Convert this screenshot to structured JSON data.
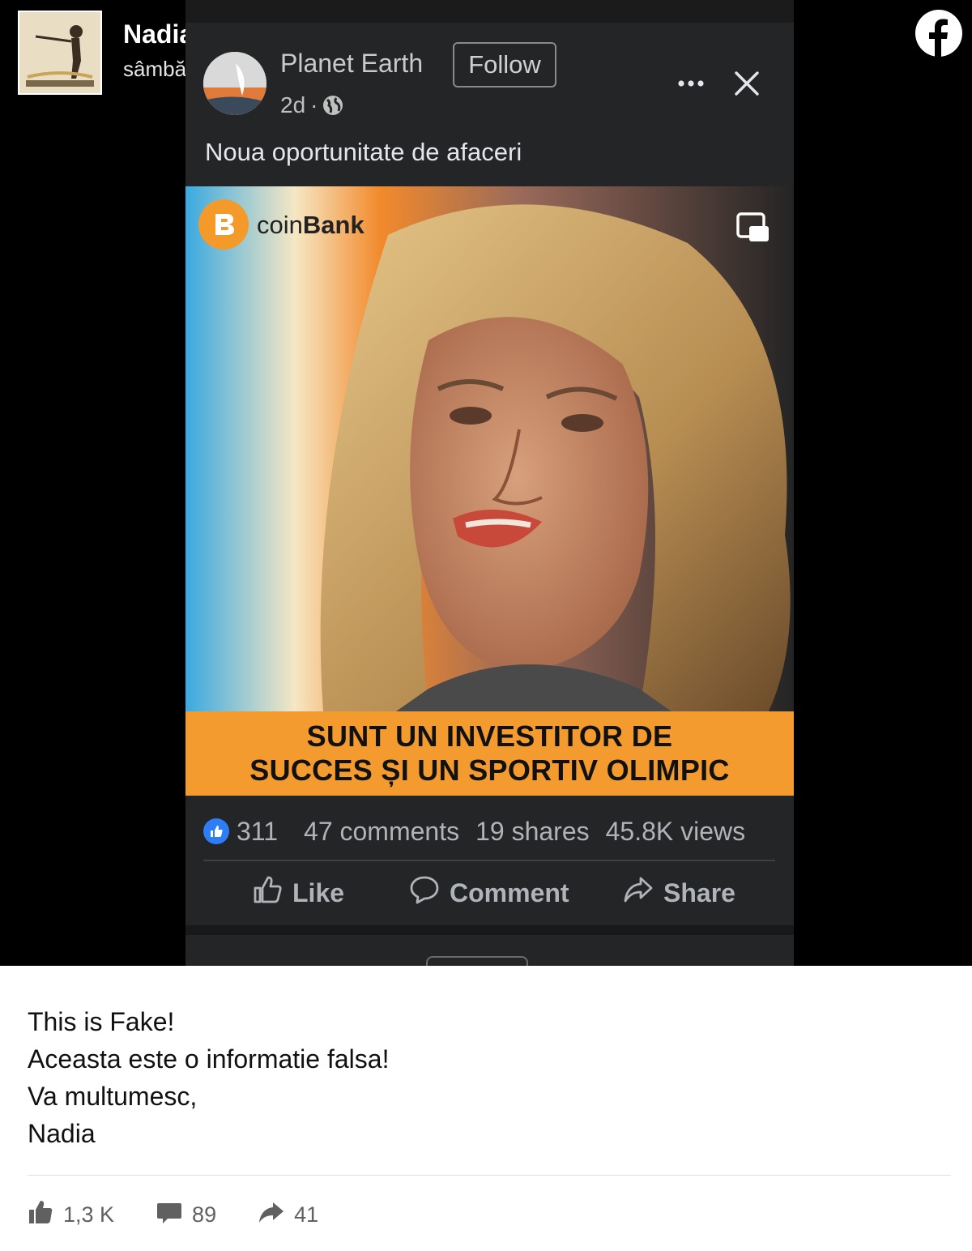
{
  "author": {
    "name": "Nadia Comaneci",
    "date": "sâmbătă"
  },
  "embedded_post": {
    "page_name": "Planet Earth",
    "follow_label": "Follow",
    "age": "2d",
    "age_separator": "·",
    "caption": "Noua oportunitate de afaceri",
    "brand": {
      "prefix": "coin",
      "suffix": "Bank"
    },
    "banner_lines": [
      "SUNT UN INVESTITOR DE",
      "SUCCES ȘI UN SPORTIV OLIMPIC"
    ],
    "stats": {
      "likes": "311",
      "comments": "47 comments",
      "shares": "19 shares",
      "views": "45.8K views"
    },
    "actions": {
      "like": "Like",
      "comment": "Comment",
      "share": "Share"
    }
  },
  "message": [
    "This is Fake!",
    "Aceasta este o informatie falsa!",
    "Va multumesc,",
    "Nadia"
  ],
  "footer": {
    "likes": "1,3 K",
    "comments": "89",
    "shares": "41"
  },
  "colors": {
    "accent_blue": "#2e7cf6",
    "banner_orange": "#f49b2f",
    "post_bg": "#242526"
  },
  "icons": [
    "verified-icon",
    "facebook-logo-icon",
    "globe-icon",
    "more-options-icon",
    "close-icon",
    "picture-in-picture-icon",
    "like-icon",
    "comment-icon",
    "share-icon"
  ]
}
